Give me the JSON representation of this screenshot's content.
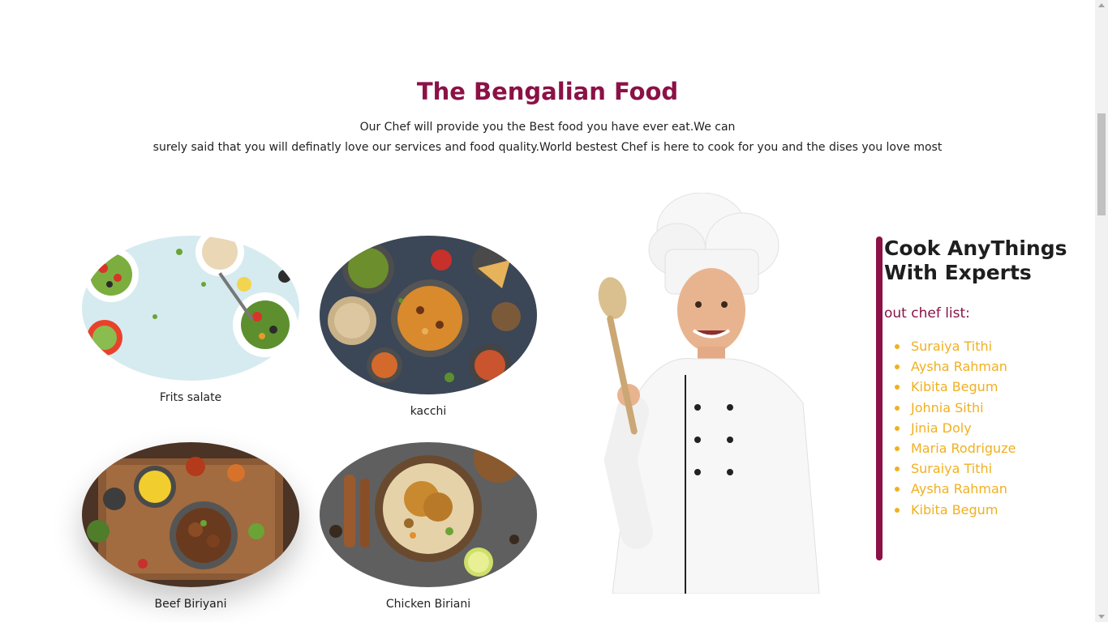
{
  "section": {
    "title": "The Bengalian Food",
    "subtitle_line1": "Our Chef will provide you the Best food you have ever eat.We can",
    "subtitle_line2": "surely said that you will definatly love our services and food quality.World bestest Chef is here to cook for you and the dises you love most"
  },
  "foods": [
    {
      "name": "Frits salate"
    },
    {
      "name": "kacchi"
    },
    {
      "name": "Beef Biriyani"
    },
    {
      "name": "Chicken Biriani"
    }
  ],
  "experts": {
    "title": "Cook AnyThings With Experts",
    "list_label": "out chef list:",
    "chefs": [
      "Suraiya Tithi",
      "Aysha Rahman",
      "Kibita Begum",
      "Johnia Sithi",
      "Jinia Doly",
      "Maria Rodriguze",
      "Suraiya Tithi",
      "Aysha Rahman",
      "Kibita Begum"
    ]
  },
  "colors": {
    "accent": "#8b1146",
    "list": "#f0b020"
  }
}
